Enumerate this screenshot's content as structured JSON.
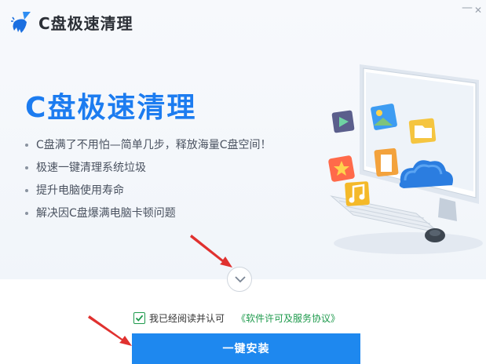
{
  "window": {
    "title": "C盘极速清理",
    "minimize_symbol": "—",
    "close_symbol": "✕"
  },
  "hero": {
    "headline": "C盘极速清理",
    "features": [
      "C盘满了不用怕—简单几步，释放海量C盘空间！",
      "极速一键清理系统垃圾",
      "提升电脑使用寿命",
      "解决因C盘爆满电脑卡顿问题"
    ]
  },
  "agreement": {
    "checked": true,
    "text": "我已经阅读并认可",
    "link": "《软件许可及服务协议》"
  },
  "install_button": {
    "label": "一键安装"
  },
  "colors": {
    "brand_blue": "#1c7cf0",
    "button_blue": "#1e88ef",
    "link_green": "#1d9a4c",
    "arrow_red": "#e0312f"
  },
  "icons": [
    "broom-logo-icon",
    "chevron-down-icon",
    "checkmark-icon",
    "computer-illustration"
  ]
}
